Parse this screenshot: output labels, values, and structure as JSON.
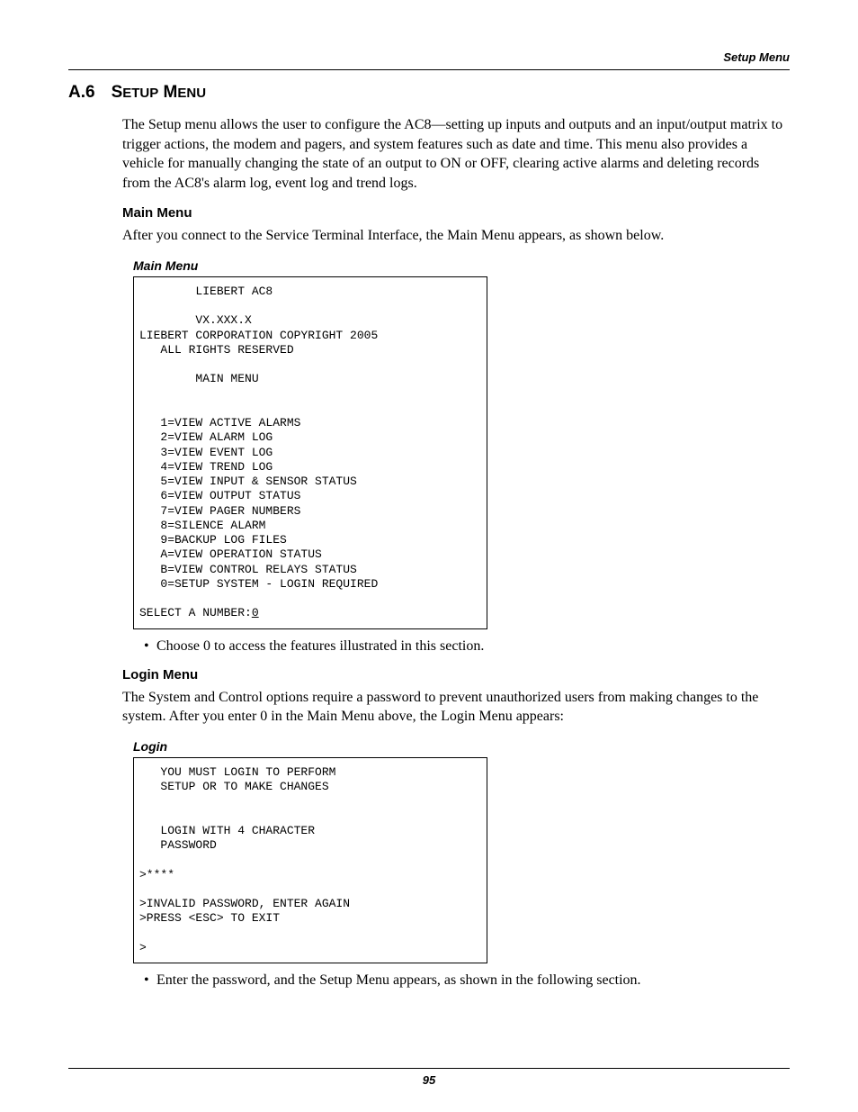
{
  "running_header": "Setup Menu",
  "section_number": "A.6",
  "section_title_html": "S<small>ETUP</small> M<small>ENU</small>",
  "intro_paragraph": "The Setup menu allows the user to configure the AC8—setting up inputs and outputs and an input/output matrix to trigger actions, the modem and pagers, and system features such as date and time. This menu also provides a vehicle for manually changing the state of an output to ON or OFF, clearing active alarms and deleting records from the AC8's alarm log, event log and trend logs.",
  "main_menu_heading": "Main Menu",
  "main_menu_desc": "After you connect to the Service Terminal Interface, the Main Menu appears, as shown below.",
  "main_menu_box_title": "Main Menu",
  "terminal_main_lines": [
    "        LIEBERT AC8",
    "",
    "        VX.XXX.X",
    "LIEBERT CORPORATION COPYRIGHT 2005",
    "   ALL RIGHTS RESERVED",
    "",
    "        MAIN MENU",
    "",
    "",
    "   1=VIEW ACTIVE ALARMS",
    "   2=VIEW ALARM LOG",
    "   3=VIEW EVENT LOG",
    "   4=VIEW TREND LOG",
    "   5=VIEW INPUT & SENSOR STATUS",
    "   6=VIEW OUTPUT STATUS",
    "   7=VIEW PAGER NUMBERS",
    "   8=SILENCE ALARM",
    "   9=BACKUP LOG FILES",
    "   A=VIEW OPERATION STATUS",
    "   B=VIEW CONTROL RELAYS STATUS",
    "   0=SETUP SYSTEM - LOGIN REQUIRED",
    ""
  ],
  "terminal_main_prompt_prefix": "SELECT A NUMBER:",
  "terminal_main_prompt_value": "0",
  "bullet_main": "Choose 0 to access the features illustrated in this section.",
  "login_heading": "Login Menu",
  "login_desc": "The System and Control options require a password to prevent unauthorized users from making changes to the system. After you enter 0 in the Main Menu above, the Login Menu appears:",
  "login_box_title": "Login",
  "terminal_login_lines": [
    "   YOU MUST LOGIN TO PERFORM",
    "   SETUP OR TO MAKE CHANGES",
    "",
    "",
    "   LOGIN WITH 4 CHARACTER",
    "   PASSWORD",
    "",
    ">****",
    "",
    ">INVALID PASSWORD, ENTER AGAIN",
    ">PRESS <ESC> TO EXIT",
    "",
    ">"
  ],
  "bullet_login": "Enter the password, and the Setup Menu appears, as shown in the following section.",
  "page_number": "95"
}
